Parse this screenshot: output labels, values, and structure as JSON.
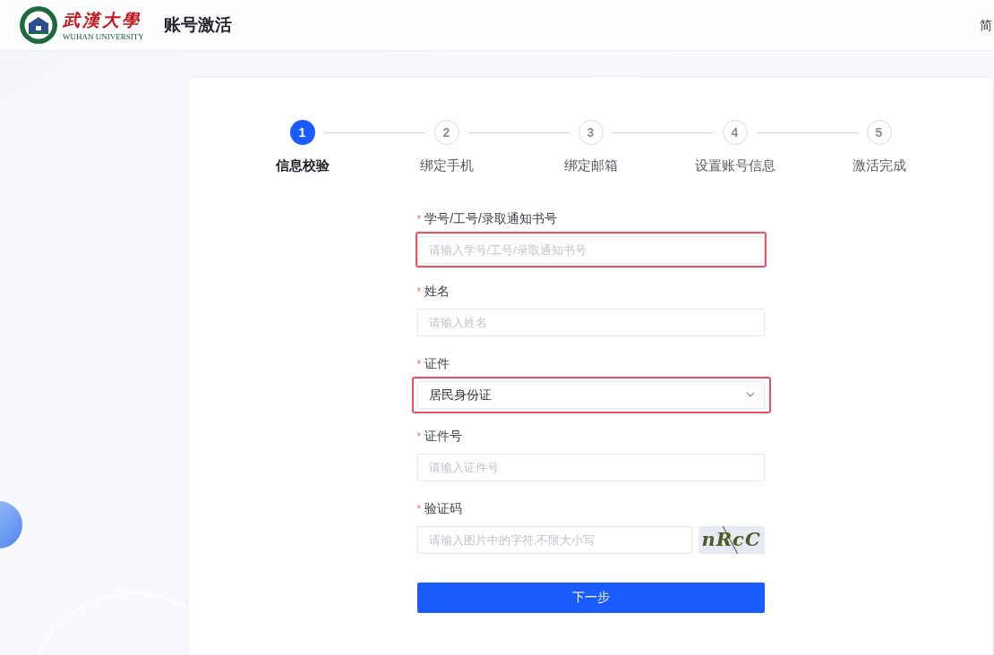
{
  "header": {
    "logo": {
      "name_cn": "武漢大學",
      "name_en": "WUHAN UNIVERSITY"
    },
    "title": "账号激活",
    "language": "简"
  },
  "steps": [
    {
      "number": "1",
      "label": "信息校验",
      "selected": true
    },
    {
      "number": "2",
      "label": "绑定手机",
      "selected": false
    },
    {
      "number": "3",
      "label": "绑定邮箱",
      "selected": false
    },
    {
      "number": "4",
      "label": "设置账号信息",
      "selected": false
    },
    {
      "number": "5",
      "label": "激活完成",
      "selected": false
    }
  ],
  "form": {
    "fields": [
      {
        "kind": "input",
        "mark": "*",
        "label": "学号/工号/录取通知书号",
        "placeholder": "请输入学号/工号/录取通知书号",
        "highlighted": true
      },
      {
        "kind": "input",
        "mark": "*",
        "label": "姓名",
        "placeholder": "请输入姓名",
        "highlighted": false
      },
      {
        "kind": "select",
        "mark": "*",
        "label": "证件",
        "value": "居民身份证",
        "highlighted": true
      },
      {
        "kind": "input",
        "mark": "*",
        "label": "证件号",
        "placeholder": "请输入证件号",
        "highlighted": false
      },
      {
        "kind": "captcha",
        "mark": "*",
        "label": "验证码",
        "placeholder": "请输入图片中的字符,不限大小写",
        "captcha_text": "nRcC",
        "highlighted": false
      }
    ],
    "submit": "下一步"
  }
}
